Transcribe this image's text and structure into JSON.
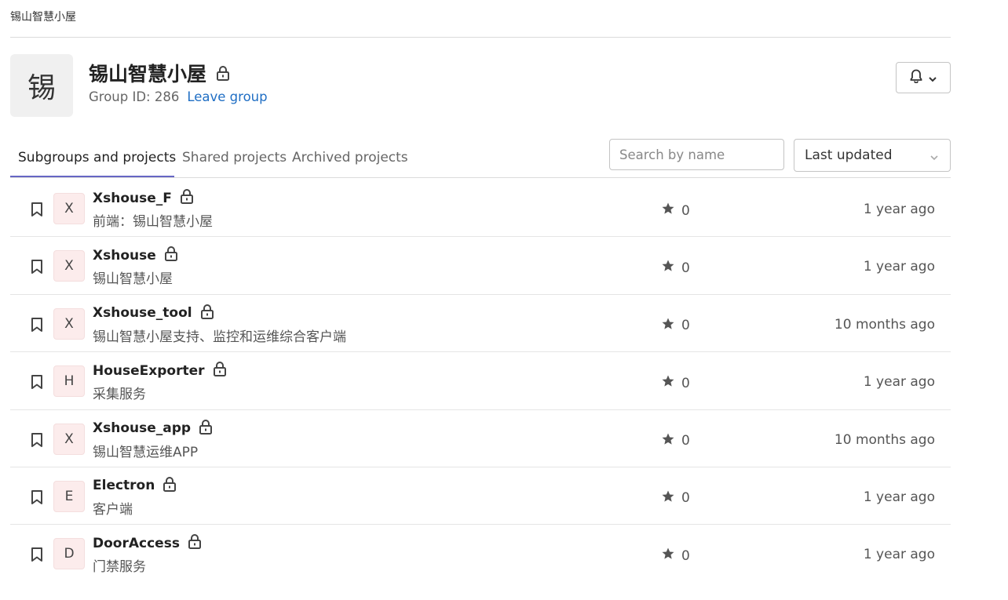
{
  "breadcrumb": "锡山智慧小屋",
  "group": {
    "avatar_letter": "锡",
    "title": "锡山智慧小屋",
    "group_id_text": "Group ID: 286",
    "leave_label": "Leave group"
  },
  "tabs": [
    {
      "label": "Subgroups and projects",
      "active": true
    },
    {
      "label": "Shared projects",
      "active": false
    },
    {
      "label": "Archived projects",
      "active": false
    }
  ],
  "search": {
    "placeholder": "Search by name"
  },
  "sort": {
    "selected": "Last updated"
  },
  "projects": [
    {
      "letter": "X",
      "name": "Xshouse_F",
      "description": "前端：锡山智慧小屋",
      "stars": "0",
      "updated": "1 year ago"
    },
    {
      "letter": "X",
      "name": "Xshouse",
      "description": "锡山智慧小屋",
      "stars": "0",
      "updated": "1 year ago"
    },
    {
      "letter": "X",
      "name": "Xshouse_tool",
      "description": "锡山智慧小屋支持、监控和运维综合客户端",
      "stars": "0",
      "updated": "10 months ago"
    },
    {
      "letter": "H",
      "name": "HouseExporter",
      "description": "采集服务",
      "stars": "0",
      "updated": "1 year ago"
    },
    {
      "letter": "X",
      "name": "Xshouse_app",
      "description": "锡山智慧运维APP",
      "stars": "0",
      "updated": "10 months ago"
    },
    {
      "letter": "E",
      "name": "Electron",
      "description": "客户端",
      "stars": "0",
      "updated": "1 year ago"
    },
    {
      "letter": "D",
      "name": "DoorAccess",
      "description": "门禁服务",
      "stars": "0",
      "updated": "1 year ago"
    }
  ]
}
